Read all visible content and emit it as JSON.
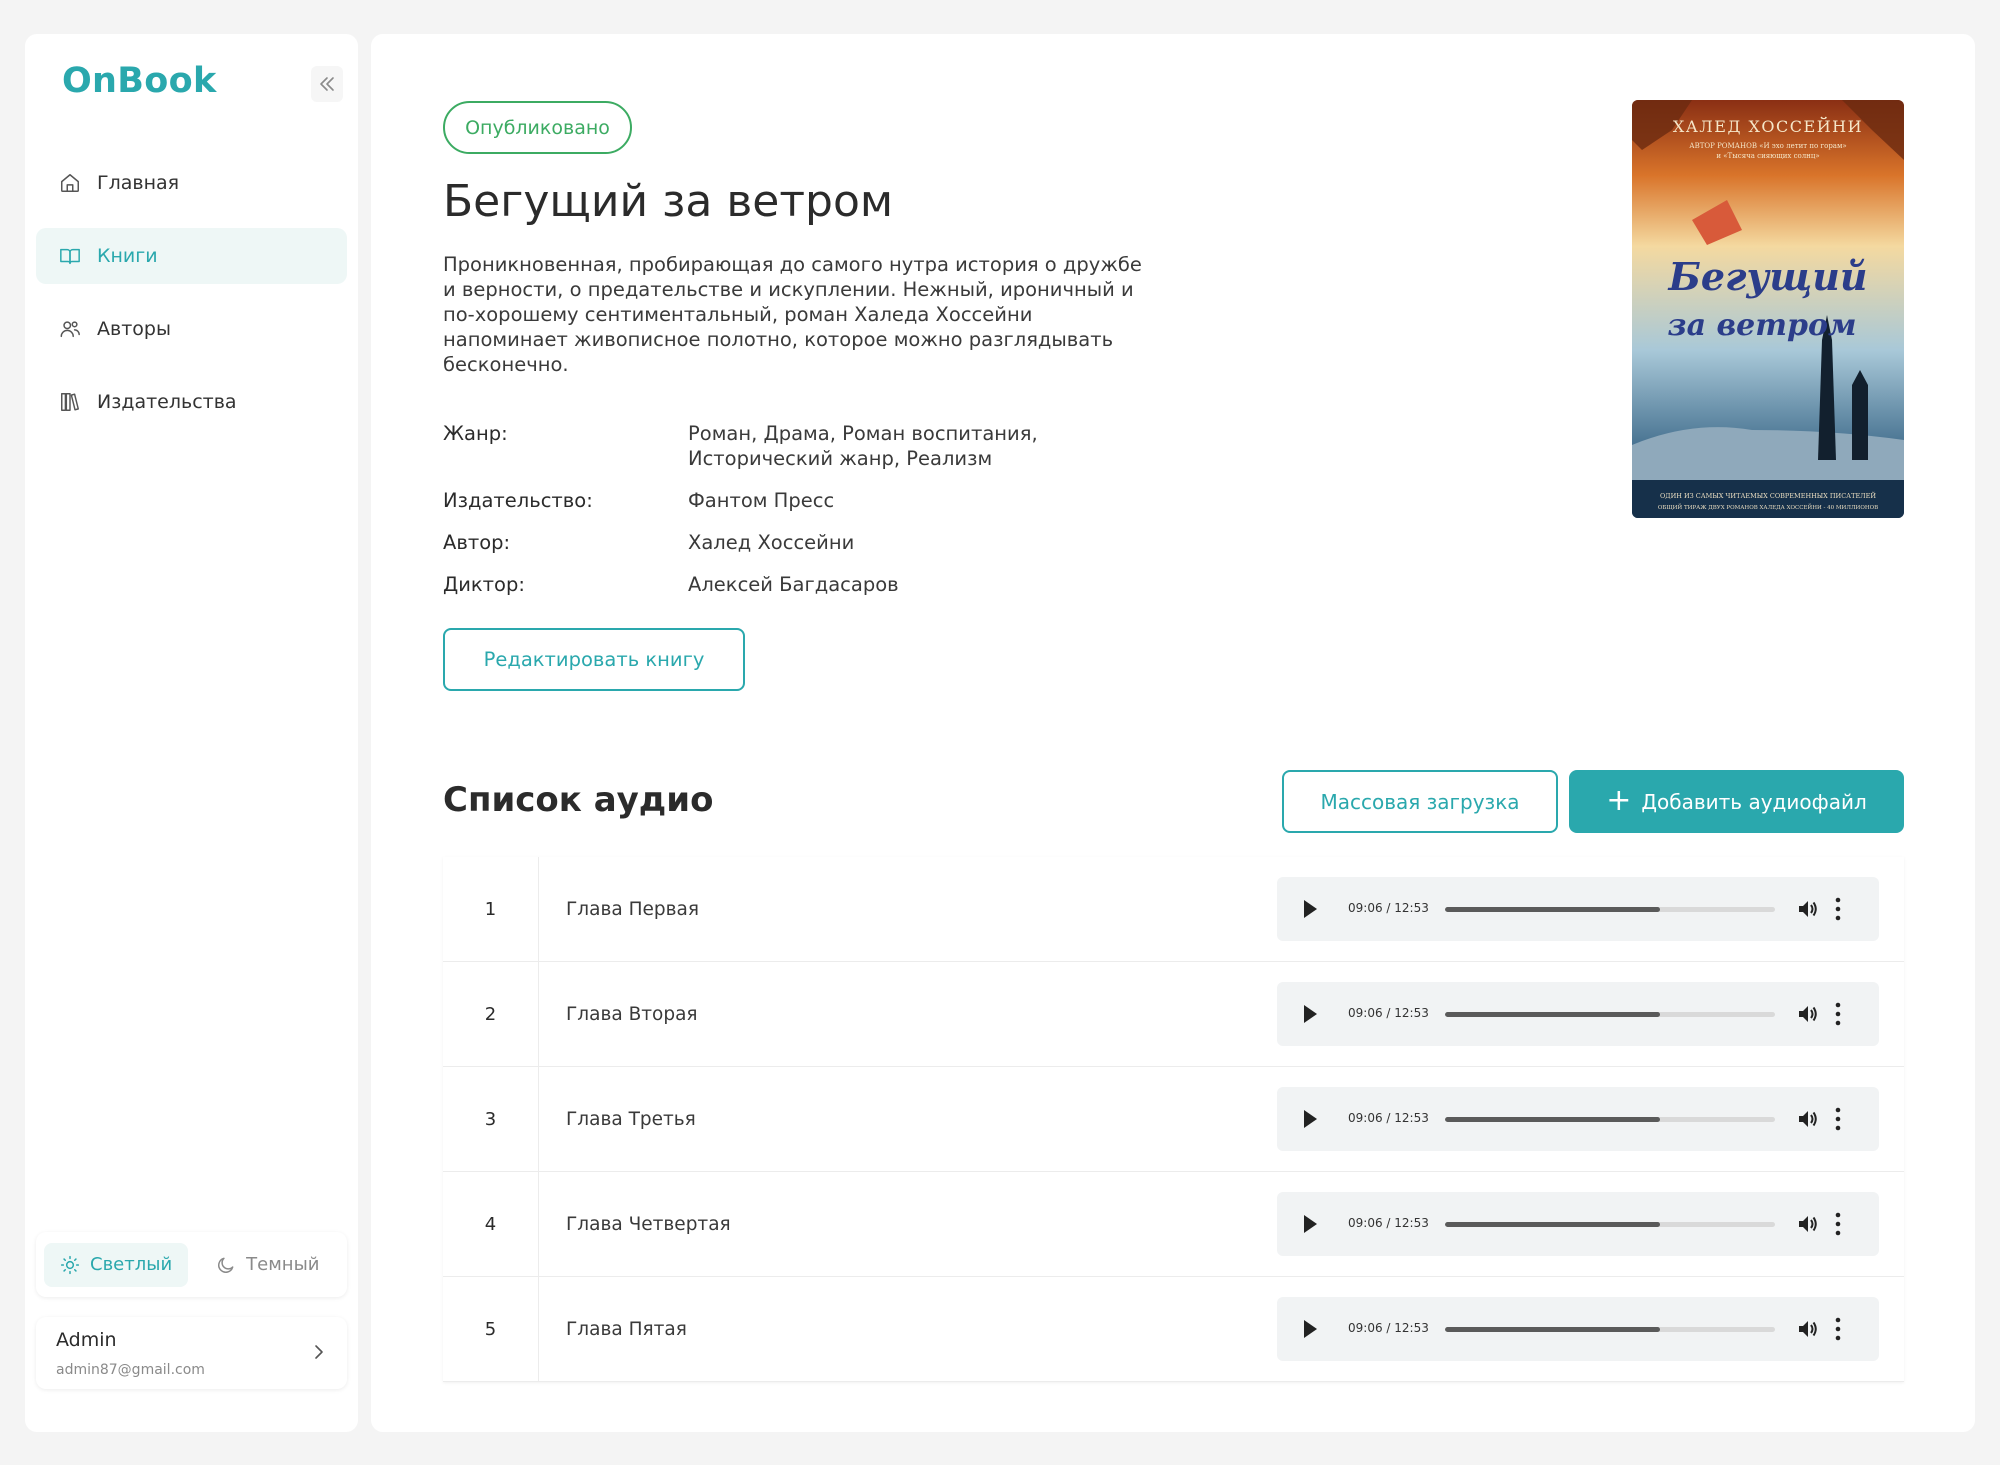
{
  "app": {
    "name": "OnBook"
  },
  "sidebar": {
    "collapse_icon": "double-chevron-left-icon",
    "items": [
      {
        "label": "Главная",
        "icon": "home-icon",
        "active": false
      },
      {
        "label": "Книги",
        "icon": "book-icon",
        "active": true
      },
      {
        "label": "Авторы",
        "icon": "users-icon",
        "active": false
      },
      {
        "label": "Издательства",
        "icon": "library-icon",
        "active": false
      }
    ],
    "theme": {
      "light_label": "Светлый",
      "dark_label": "Темный",
      "selected": "light"
    },
    "user": {
      "name": "Admin",
      "email": "admin87@gmail.com"
    }
  },
  "book": {
    "status": "Опубликовано",
    "title": "Бегущий за ветром",
    "description": "Проникновенная, пробирающая до самого нутра история о дружбе и верности, о предательстве и искуплении. Нежный, ироничный и по-хорошему сентиментальный, роман Халеда Хоссейни напоминает живописное полотно, которое можно разглядывать бесконечно.",
    "meta": [
      {
        "key": "Жанр:",
        "value": "Роман, Драма, Роман воспитания, Исторический жанр, Реализм"
      },
      {
        "key": "Издательство:",
        "value": "Фантом Пресс"
      },
      {
        "key": "Автор:",
        "value": "Халед Хоссейни"
      },
      {
        "key": "Диктор:",
        "value": "Алексей Багдасаров"
      }
    ],
    "edit_label": "Редактировать книгу",
    "cover": {
      "author": "ХАЛЕД ХОССЕЙНИ",
      "subtitle_1": "АВТОР РОМАНОВ «И эхо летит по горам»",
      "subtitle_2": "и «Тысяча сияющих солнц»",
      "title_1": "Бегущий",
      "title_2": "за ветром",
      "footer_1": "ОДИН ИЗ САМЫХ ЧИТАЕМЫХ СОВРЕМЕННЫХ ПИСАТЕЛЕЙ",
      "footer_2": "ОБЩИЙ ТИРАЖ ДВУХ РОМАНОВ ХАЛЕДА ХОССЕЙНИ - 40 МИЛЛИОНОВ"
    }
  },
  "audio": {
    "title": "Список аудио",
    "bulk_label": "Массовая загрузка",
    "add_label": "Добавить аудиофайл",
    "colors": {
      "accent": "#2aa8ad",
      "published": "#3cab62"
    },
    "items": [
      {
        "num": "1",
        "name": "Глава Первая",
        "time": "09:06 / 12:53",
        "progress": 0.65
      },
      {
        "num": "2",
        "name": "Глава Вторая",
        "time": "09:06 / 12:53",
        "progress": 0.65
      },
      {
        "num": "3",
        "name": "Глава Третья",
        "time": "09:06 / 12:53",
        "progress": 0.65
      },
      {
        "num": "4",
        "name": "Глава Четвертая",
        "time": "09:06 / 12:53",
        "progress": 0.65
      },
      {
        "num": "5",
        "name": "Глава Пятая",
        "time": "09:06 / 12:53",
        "progress": 0.65
      }
    ]
  }
}
